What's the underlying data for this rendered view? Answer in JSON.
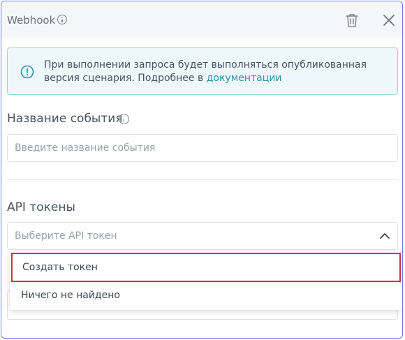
{
  "header": {
    "title": "Webhook",
    "info_icon": "info-icon",
    "trash_icon": "trash-icon",
    "close_icon": "close-icon"
  },
  "notice": {
    "text": "При выполнении запроса будет выполняться опубликованная версия сценария. Подробнее в ",
    "link_text": "документации",
    "icon": "alert-circle-icon",
    "accent_color": "#2f8fa8"
  },
  "event_name": {
    "label": "Название события",
    "placeholder": "Введите название события",
    "value": ""
  },
  "api_tokens": {
    "label": "API токены",
    "placeholder": "Выберите API токен",
    "expanded": true,
    "options": [
      {
        "label": "Создать токен",
        "highlighted": true
      },
      {
        "label": "Ничего не найдено",
        "highlighted": false
      }
    ]
  },
  "colors": {
    "panel_border": "#6b7ce6",
    "highlight_border": "#d0303a",
    "notice_bg": "#eef8fb",
    "notice_border": "#9cd3df"
  }
}
